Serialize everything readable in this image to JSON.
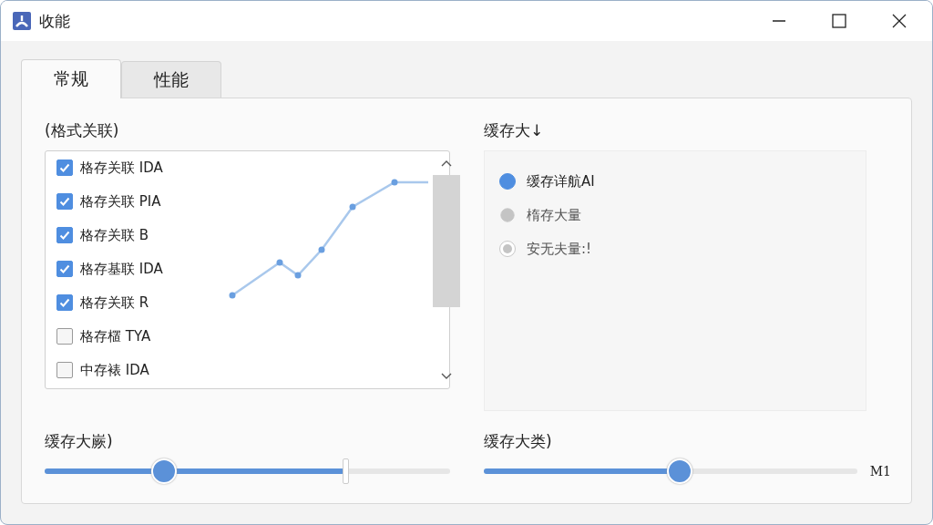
{
  "window": {
    "title": "收能"
  },
  "tabs": [
    {
      "label": "常规",
      "selected": true
    },
    {
      "label": "性能",
      "selected": false
    }
  ],
  "left": {
    "heading": "(格式关联)",
    "items": [
      {
        "label": "格存关联 IDA",
        "checked": true
      },
      {
        "label": "格存关联 PIA",
        "checked": true
      },
      {
        "label": "格存关联 B",
        "checked": true
      },
      {
        "label": "格存基联 IDA",
        "checked": true
      },
      {
        "label": "格存关联 R",
        "checked": true
      },
      {
        "label": "格存㯰 TYA",
        "checked": false
      },
      {
        "label": "中存裱 IDA",
        "checked": false
      }
    ]
  },
  "right": {
    "heading": "缓存大↓",
    "options": [
      {
        "label": "缓存详航AI",
        "selected": true,
        "disabled": false
      },
      {
        "label": "楕存大量",
        "selected": false,
        "disabled": true
      },
      {
        "label": "安无夫量:!",
        "selected": true,
        "disabled": true
      }
    ]
  },
  "sliders": [
    {
      "label": "缓存大嶡)",
      "handles": [
        {
          "level": 0.29
        },
        {
          "level": 0.74
        }
      ]
    },
    {
      "label": "缓存大类)",
      "handles": [
        {
          "level": 0.52
        }
      ],
      "reading": "M1"
    }
  ]
}
